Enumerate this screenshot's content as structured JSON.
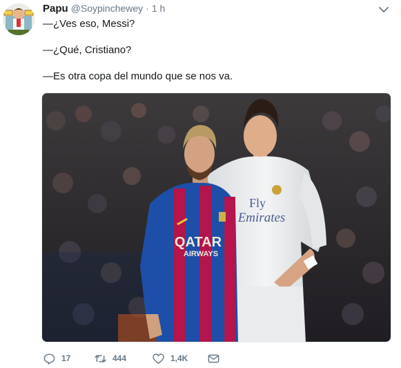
{
  "tweet": {
    "author_name": "Papu",
    "author_handle": "@Soypinchewey",
    "separator": "·",
    "timestamp": "1 h",
    "lines": [
      "—¿Ves eso, Messi?",
      "—¿Qué, Cristiano?",
      "—Es otra copa del mundo que se nos va."
    ],
    "media": {
      "left_jersey_sponsor_top": "QATAR",
      "left_jersey_sponsor_bottom": "AIRWAYS",
      "right_jersey_sponsor_top": "Fly",
      "right_jersey_sponsor_bottom": "Emirates"
    },
    "stats": {
      "replies": "17",
      "retweets": "444",
      "likes": "1,4K"
    }
  },
  "icons": {
    "caret": "chevron-down-icon",
    "reply": "reply-icon",
    "retweet": "retweet-icon",
    "like": "heart-icon",
    "message": "envelope-icon"
  },
  "colors": {
    "text": "#14171a",
    "secondary": "#657786",
    "barca_blue": "#1d4fa8",
    "barca_red": "#b3154c",
    "madrid_white": "#eef0f2"
  }
}
